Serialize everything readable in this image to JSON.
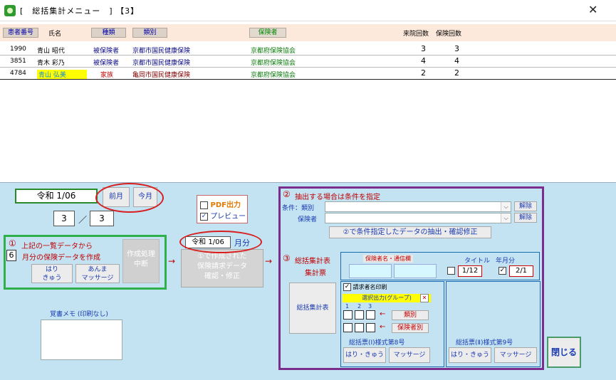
{
  "window": {
    "title": "[　総括集計メニュー　] 【3】",
    "close": "✕"
  },
  "columns": {
    "patient_no": "患者番号",
    "name": "氏名",
    "type": "種類",
    "category": "類別",
    "insurer": "保険者",
    "visits": "来院回数",
    "insurance_count": "保険回数"
  },
  "rows": [
    {
      "no": "1990",
      "name": "青山 昭代",
      "type": "被保険者",
      "category": "京都市国民健康保険",
      "insurer": "京都府保険協会",
      "visits": "3",
      "ins": "3"
    },
    {
      "no": "3851",
      "name": "青木 彩乃",
      "type": "被保険者",
      "category": "京都市国民健康保険",
      "insurer": "京都府保険協会",
      "visits": "4",
      "ins": "4"
    },
    {
      "no": "4784",
      "name": "青山 弘美",
      "type": "家族",
      "category": "亀岡市国民健康保険",
      "insurer": "京都府保険協会",
      "visits": "2",
      "ins": "2"
    }
  ],
  "period": {
    "date": "令和 1/06",
    "prev": "前月",
    "this": "今月",
    "count_a": "3",
    "sep": "／",
    "count_b": "3"
  },
  "section1": {
    "num": "①",
    "line1": "上記の一覧データから",
    "month_val": "6",
    "line2": "月分の保険データを作成",
    "hari": "はり\nきゅう",
    "anma": "あんま\nマッサージ",
    "interrupt": "作成処理\n中断"
  },
  "pdf": {
    "pdf_label": "PDF出力",
    "preview_label": "プレビュー",
    "preview_checked": true
  },
  "edit": {
    "date": "令和 1/06",
    "suffix": "月分",
    "label": "①で作成された\n保険請求データ\n確認・修正"
  },
  "arrow": "→",
  "memo": {
    "label": "覚書メモ (印刷なし)"
  },
  "section2": {
    "num": "②",
    "title": "抽出する場合は条件を指定",
    "cond_type": "条件：類別",
    "cond_insurer": "保険者",
    "clear": "解除",
    "extract": "②で条件指定したデータの抽出・確認修正"
  },
  "section3": {
    "num": "③",
    "title": "総括集計表",
    "subtitle": "集計票",
    "insurer_name": "保険者名・通信欄",
    "title_lbl": "タイトル",
    "ym_lbl": "年月分",
    "title_val": "1/12",
    "ym_val": "2/1",
    "ym_checked": true,
    "summary_btn": "総括集計表",
    "print_name": "請求者名印刷",
    "print_checked": true,
    "group": "選択出力(グループ)",
    "group_close": "✕",
    "col1": "1",
    "col2": "2",
    "col3": "3",
    "by_cat": "類別",
    "by_ins": "保険者別",
    "form8": "総括票(Ⅰ)様式第8号",
    "form9": "総括票(Ⅱ)様式第9号",
    "hari": "はり・きゅう",
    "massage": "マッサージ"
  },
  "close_btn": "閉じる"
}
